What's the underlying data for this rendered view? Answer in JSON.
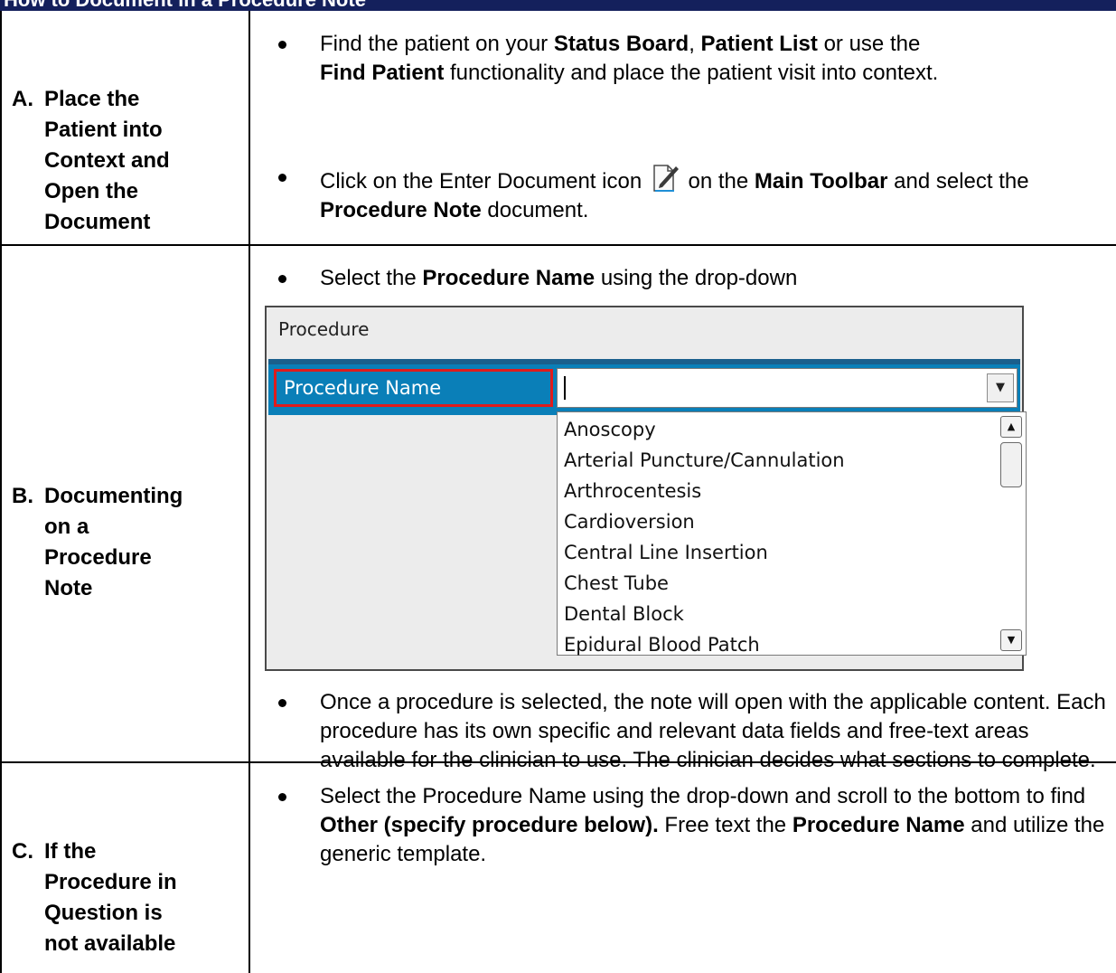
{
  "title": "How to Document in a Procedure Note",
  "sections": [
    {
      "letter": "A.",
      "label": "Place the Patient into Context and Open the Document",
      "bullets": [
        {
          "parts": [
            "Find the patient on your ",
            "Status Board",
            ", ",
            "Patient List",
            " or use the ",
            "Find Patient",
            " functionality and place the patient visit into context."
          ]
        },
        {
          "parts": [
            "Click on the Enter Document icon ",
            " on the ",
            "Main Toolbar",
            " and select the ",
            "Procedure Note",
            " document."
          ],
          "icon": "enter-document-icon"
        }
      ]
    },
    {
      "letter": "B.",
      "label": "Documenting on a Procedure Note",
      "bullets": [
        {
          "parts": [
            "Select the ",
            "Procedure Name",
            " using the drop-down"
          ]
        },
        {
          "text": "Once a procedure is selected, the note will open with the applicable content. Each procedure has its own specific and relevant data fields and free-text areas available for the clinician to use. The clinician decides what sections to complete."
        }
      ]
    },
    {
      "letter": "C.",
      "label": "If the Procedure in Question is not available",
      "bullets": [
        {
          "parts": [
            "Select the Procedure Name using the drop-down and scroll to the bottom to find ",
            "Other (specify procedure below).",
            " Free text the ",
            "Procedure Name",
            " and utilize the generic template."
          ]
        }
      ]
    }
  ],
  "procedure_ui": {
    "section_title": "Procedure",
    "field_label": "Procedure Name",
    "input_value": "",
    "options": [
      "Anoscopy",
      "Arterial Puncture/Cannulation",
      "Arthrocentesis",
      "Cardioversion",
      "Central Line Insertion",
      "Chest Tube",
      "Dental Block",
      "Epidural Blood Patch"
    ]
  },
  "colors": {
    "title_bar": "#14205c",
    "row_highlight": "#0a7fb8",
    "label_outline": "#e01b1b"
  }
}
